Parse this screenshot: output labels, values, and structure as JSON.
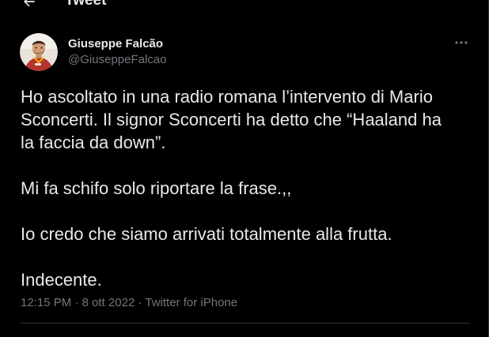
{
  "header": {
    "title": "Tweet",
    "back_icon": "arrow-left-icon"
  },
  "tweet": {
    "author": {
      "display_name": "Giuseppe Falcão",
      "handle": "@GiuseppeFalcao",
      "avatar_icon": "profile-photo"
    },
    "more_icon": "more-horizontal-icon",
    "paragraphs": [
      [
        "Ho ascoltato in una radio romana l’intervento di Mario",
        "Sconcerti. Il signor Sconcerti ha detto che “Haaland ha",
        "la faccia da down”."
      ],
      [
        "Mi fa schifo solo riportare la frase.,,"
      ],
      [
        "Io credo che siamo arrivati totalmente alla frutta."
      ],
      [
        "Indecente."
      ]
    ],
    "meta": {
      "time": "12:15 PM",
      "separator": "·",
      "date": "8 ott 2022",
      "source": "Twitter for iPhone"
    }
  },
  "colors": {
    "background": "#000000",
    "text_primary": "#e7e9ea",
    "text_secondary": "#71767b",
    "border": "#2f3336",
    "avatar_shirt": "#b5332e"
  }
}
